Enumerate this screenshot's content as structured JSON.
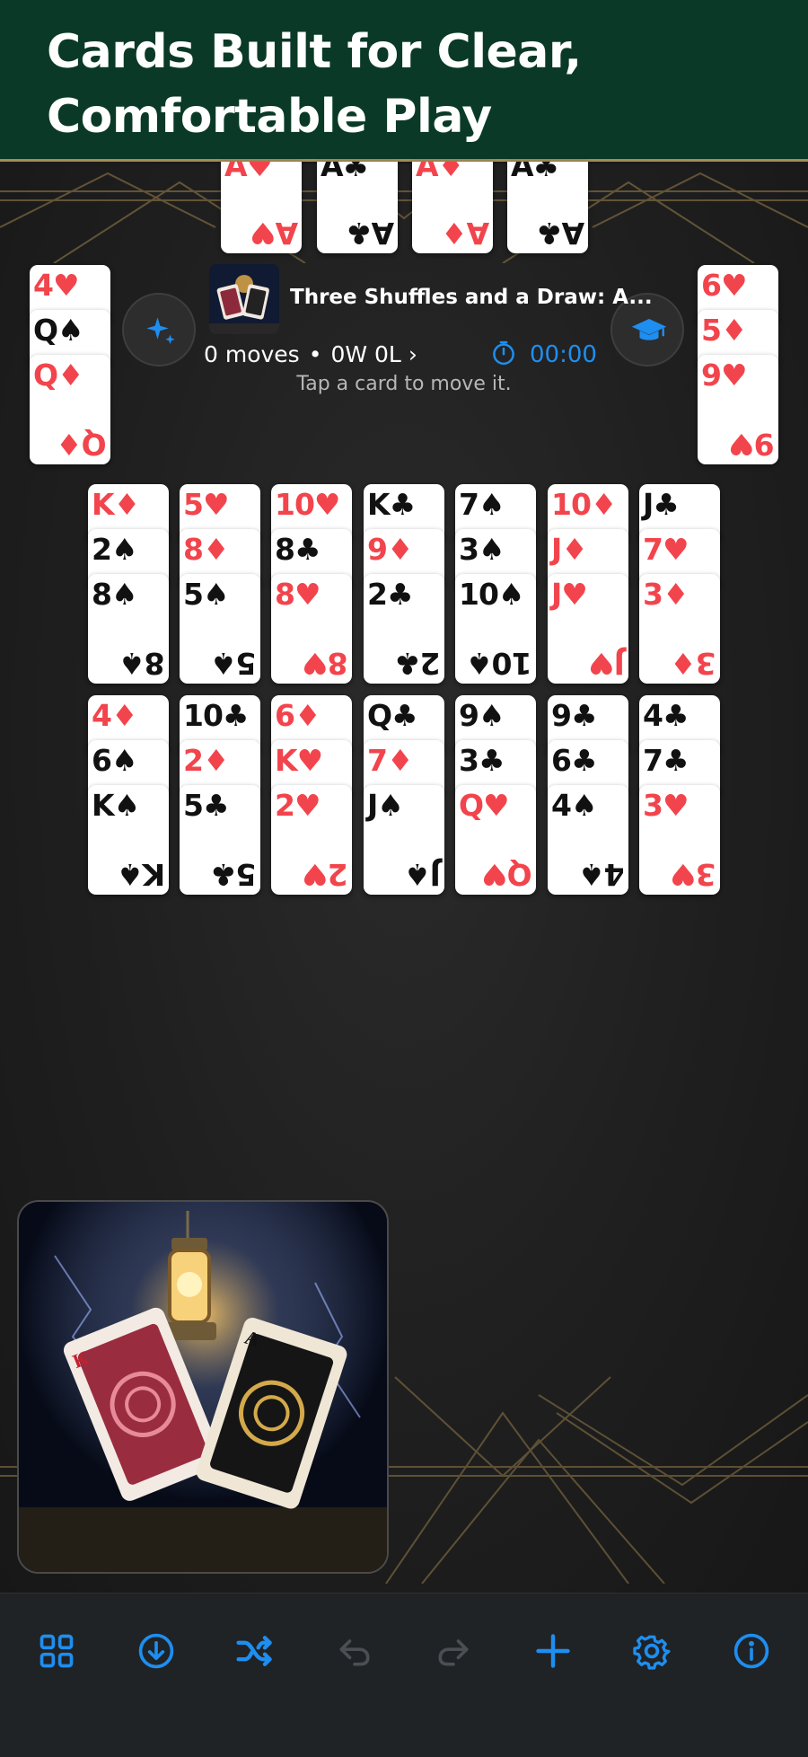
{
  "header": {
    "title": "Cards Built for Clear, Comfortable Play"
  },
  "foundations": [
    {
      "rank": "A",
      "suit": "♥",
      "color": "red"
    },
    {
      "rank": "A",
      "suit": "♣",
      "color": "black"
    },
    {
      "rank": "A",
      "suit": "♦",
      "color": "red"
    },
    {
      "rank": "A",
      "suit": "♣",
      "color": "black"
    }
  ],
  "left_pile": [
    {
      "rank": "4",
      "suit": "♥",
      "color": "red"
    },
    {
      "rank": "Q",
      "suit": "♠",
      "color": "black"
    },
    {
      "rank": "Q",
      "suit": "♦",
      "color": "red"
    }
  ],
  "right_pile": [
    {
      "rank": "6",
      "suit": "♥",
      "color": "red"
    },
    {
      "rank": "5",
      "suit": "♦",
      "color": "red"
    },
    {
      "rank": "9",
      "suit": "♥",
      "color": "red"
    }
  ],
  "game": {
    "title": "Three Shuffles and a Draw: A...",
    "moves": "0 moves",
    "separator": "•",
    "record": "0W 0L",
    "record_chevron": "›",
    "timer": "00:00",
    "hint": "Tap a card to move it."
  },
  "tableau_row1": [
    [
      {
        "rank": "K",
        "suit": "♦",
        "color": "red"
      },
      {
        "rank": "2",
        "suit": "♠",
        "color": "black"
      },
      {
        "rank": "8",
        "suit": "♠",
        "color": "black"
      }
    ],
    [
      {
        "rank": "5",
        "suit": "♥",
        "color": "red"
      },
      {
        "rank": "8",
        "suit": "♦",
        "color": "red"
      },
      {
        "rank": "5",
        "suit": "♠",
        "color": "black"
      }
    ],
    [
      {
        "rank": "10",
        "suit": "♥",
        "color": "red"
      },
      {
        "rank": "8",
        "suit": "♣",
        "color": "black"
      },
      {
        "rank": "8",
        "suit": "♥",
        "color": "red"
      }
    ],
    [
      {
        "rank": "K",
        "suit": "♣",
        "color": "black"
      },
      {
        "rank": "9",
        "suit": "♦",
        "color": "red"
      },
      {
        "rank": "2",
        "suit": "♣",
        "color": "black"
      }
    ],
    [
      {
        "rank": "7",
        "suit": "♠",
        "color": "black"
      },
      {
        "rank": "3",
        "suit": "♠",
        "color": "black"
      },
      {
        "rank": "10",
        "suit": "♠",
        "color": "black"
      }
    ],
    [
      {
        "rank": "10",
        "suit": "♦",
        "color": "red"
      },
      {
        "rank": "J",
        "suit": "♦",
        "color": "red"
      },
      {
        "rank": "J",
        "suit": "♥",
        "color": "red"
      }
    ],
    [
      {
        "rank": "J",
        "suit": "♣",
        "color": "black"
      },
      {
        "rank": "7",
        "suit": "♥",
        "color": "red"
      },
      {
        "rank": "3",
        "suit": "♦",
        "color": "red"
      }
    ]
  ],
  "tableau_row2": [
    [
      {
        "rank": "4",
        "suit": "♦",
        "color": "red"
      },
      {
        "rank": "6",
        "suit": "♠",
        "color": "black"
      },
      {
        "rank": "K",
        "suit": "♠",
        "color": "black"
      }
    ],
    [
      {
        "rank": "10",
        "suit": "♣",
        "color": "black"
      },
      {
        "rank": "2",
        "suit": "♦",
        "color": "red"
      },
      {
        "rank": "5",
        "suit": "♣",
        "color": "black"
      }
    ],
    [
      {
        "rank": "6",
        "suit": "♦",
        "color": "red"
      },
      {
        "rank": "K",
        "suit": "♥",
        "color": "red"
      },
      {
        "rank": "2",
        "suit": "♥",
        "color": "red"
      }
    ],
    [
      {
        "rank": "Q",
        "suit": "♣",
        "color": "black"
      },
      {
        "rank": "7",
        "suit": "♦",
        "color": "red"
      },
      {
        "rank": "J",
        "suit": "♠",
        "color": "black"
      }
    ],
    [
      {
        "rank": "9",
        "suit": "♠",
        "color": "black"
      },
      {
        "rank": "3",
        "suit": "♣",
        "color": "black"
      },
      {
        "rank": "Q",
        "suit": "♥",
        "color": "red"
      }
    ],
    [
      {
        "rank": "9",
        "suit": "♣",
        "color": "black"
      },
      {
        "rank": "6",
        "suit": "♣",
        "color": "black"
      },
      {
        "rank": "4",
        "suit": "♠",
        "color": "black"
      }
    ],
    [
      {
        "rank": "4",
        "suit": "♣",
        "color": "black"
      },
      {
        "rank": "7",
        "suit": "♣",
        "color": "black"
      },
      {
        "rank": "3",
        "suit": "♥",
        "color": "red"
      }
    ]
  ],
  "toolbar": [
    {
      "name": "grid-icon",
      "enabled": true
    },
    {
      "name": "download-icon",
      "enabled": true
    },
    {
      "name": "shuffle-icon",
      "enabled": true
    },
    {
      "name": "undo-icon",
      "enabled": false
    },
    {
      "name": "redo-icon",
      "enabled": false
    },
    {
      "name": "plus-icon",
      "enabled": true
    },
    {
      "name": "gear-icon",
      "enabled": true
    },
    {
      "name": "info-icon",
      "enabled": true
    }
  ],
  "colors": {
    "accent": "#1e8ef0",
    "header_bg": "#0a3a27",
    "red_suit": "#f2444c",
    "disabled": "#4a4f54"
  }
}
